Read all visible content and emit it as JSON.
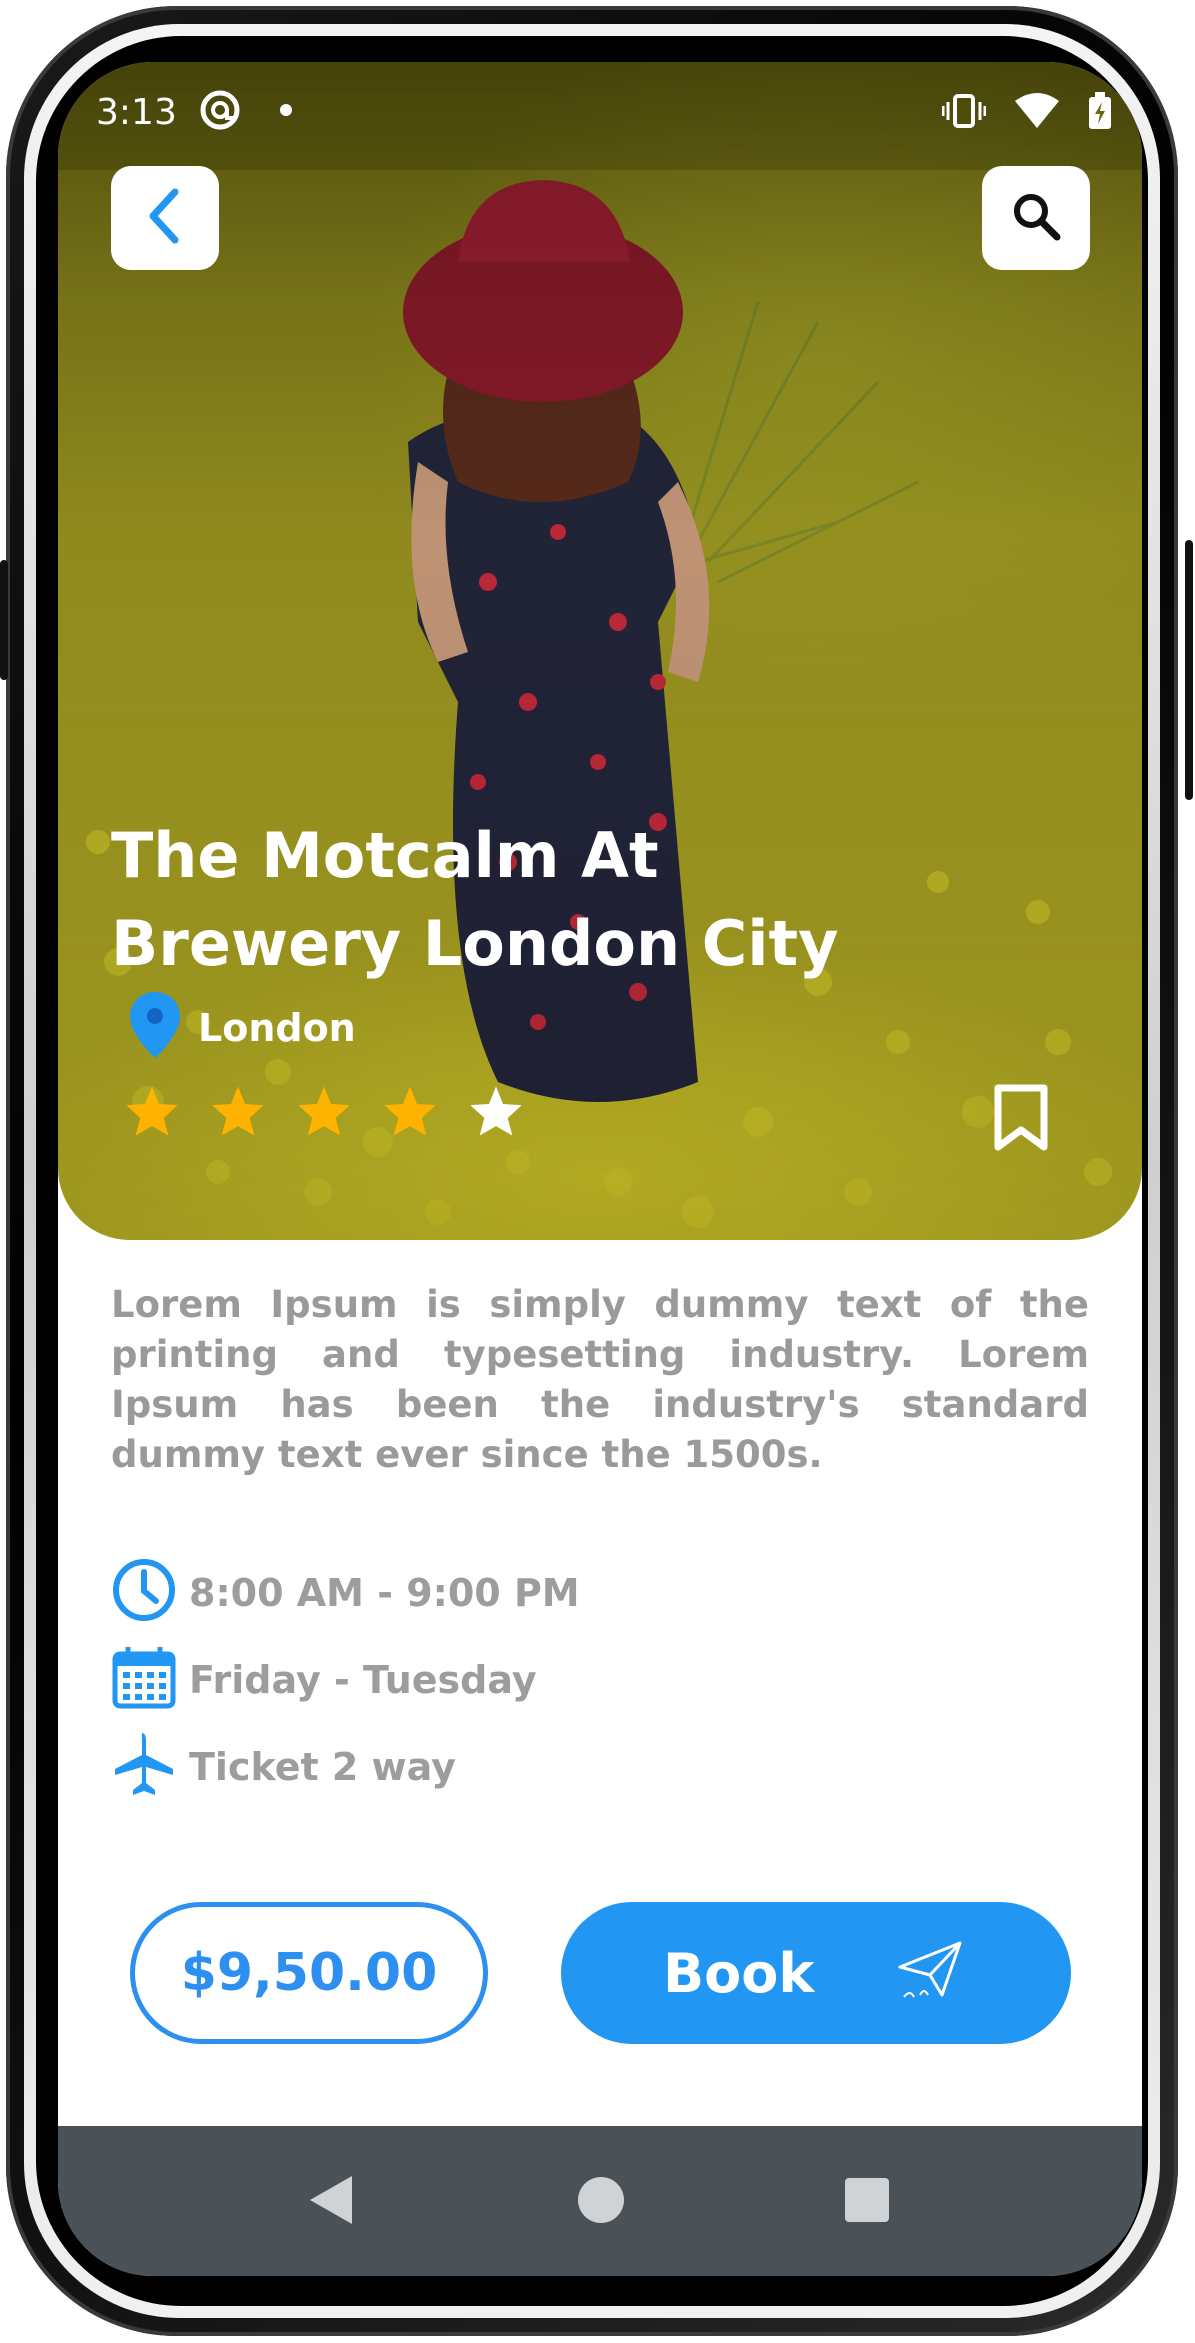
{
  "status_bar": {
    "time": "3:13",
    "icons": [
      "at-sign-icon",
      "dot-icon",
      "vibrate-icon",
      "wifi-icon",
      "battery-charging-icon"
    ]
  },
  "header": {
    "back_icon": "chevron-left-icon",
    "search_icon": "search-icon"
  },
  "hero": {
    "title_line1": "The Motcalm At",
    "title_line2": "Brewery London City",
    "location": "London",
    "rating": 4,
    "rating_max": 5
  },
  "description": "Lorem Ipsum is simply dummy text of the printing and typesetting industry. Lorem Ipsum has been the industry's standard dummy text ever since the 1500s.",
  "details": [
    {
      "icon": "clock-icon",
      "text": "8:00 AM - 9:00 PM"
    },
    {
      "icon": "calendar-icon",
      "text": "Friday - Tuesday"
    },
    {
      "icon": "airplane-icon",
      "text": "Ticket 2 way"
    }
  ],
  "actions": {
    "price": "$9,50.00",
    "book_label": "Book",
    "book_icon": "paper-plane-icon"
  },
  "nav": [
    "back-triangle-icon",
    "home-circle-icon",
    "recents-square-icon"
  ],
  "colors": {
    "accent": "#2196F3",
    "star_filled": "#FFB300",
    "star_empty": "#FFFFFF",
    "text_muted": "#9A9A9A",
    "navbar": "#4B5257"
  }
}
